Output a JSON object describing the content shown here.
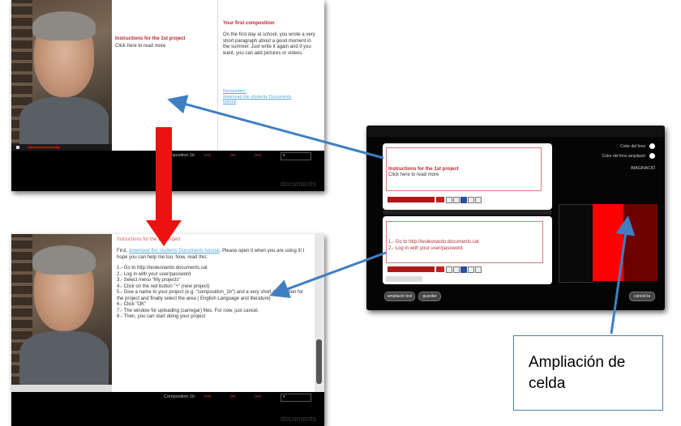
{
  "top_screenshot": {
    "instructions_title": "Instructions for the 1st project",
    "click_more": "Click here to read more",
    "composition_title": "Your first composition",
    "composition_text": "On the first day at school, you wrote a very short paragraph about a good moment in the summer. Just write it again and if you want, you can add pictures or videos.",
    "remember": "Remember!",
    "download_link": "download the students Documents tutorial",
    "bar_label": "Composition 1b",
    "brand": "documents"
  },
  "bottom_screenshot": {
    "title": "Instructions for the 1st project",
    "intro_first": "First, ",
    "intro_link": "download the students Documents tutorial",
    "intro_rest": ". Please open it when you are using it! I hope you can help me too. Now, read this:",
    "steps": [
      "1.- Go to http://iesleonardo.documents.cat",
      "2.- Log in with your user/password",
      "3.- Select menu \"My projects\"",
      "4.- Click on the red button \"+\" (new project)",
      "5.- Give a name to your project (e.g. \"composition_1b\") and a very short description for the project and finally select the area ( English Language and literature)",
      "6.- Click \"OK\"",
      "7.- The window for uploading (carregar) files. For now, just cancel.",
      "8.- Then, you can start doing your project"
    ],
    "bar_label": "Composition 1b",
    "brand": "documents"
  },
  "editor": {
    "cell1_title": "Instructions for the 1st project",
    "cell1_text": "Click here to read more",
    "cell2_line1": "1.- Go to http://iesleonardo.documents.cat",
    "cell2_line2": "2.- Log in with your user/password",
    "font_select": "Arial",
    "opt_bg": "Color del fons",
    "opt_bg_alt": "Color del fons ampliació",
    "opt_section": "IMAGINACIÓ",
    "btn_left1": "ampliació text",
    "btn_left2": "guardar",
    "btn_right": "cancel·la",
    "colors": {
      "cell_border": "#e07a7a",
      "accent_red": "#ff0000",
      "dark_red": "#6e0000"
    }
  },
  "callout": {
    "line1": "Ampliación de",
    "line2": "celda"
  },
  "arrow_colors": {
    "blue": "#3f7fc1",
    "red": "#ee1111"
  }
}
